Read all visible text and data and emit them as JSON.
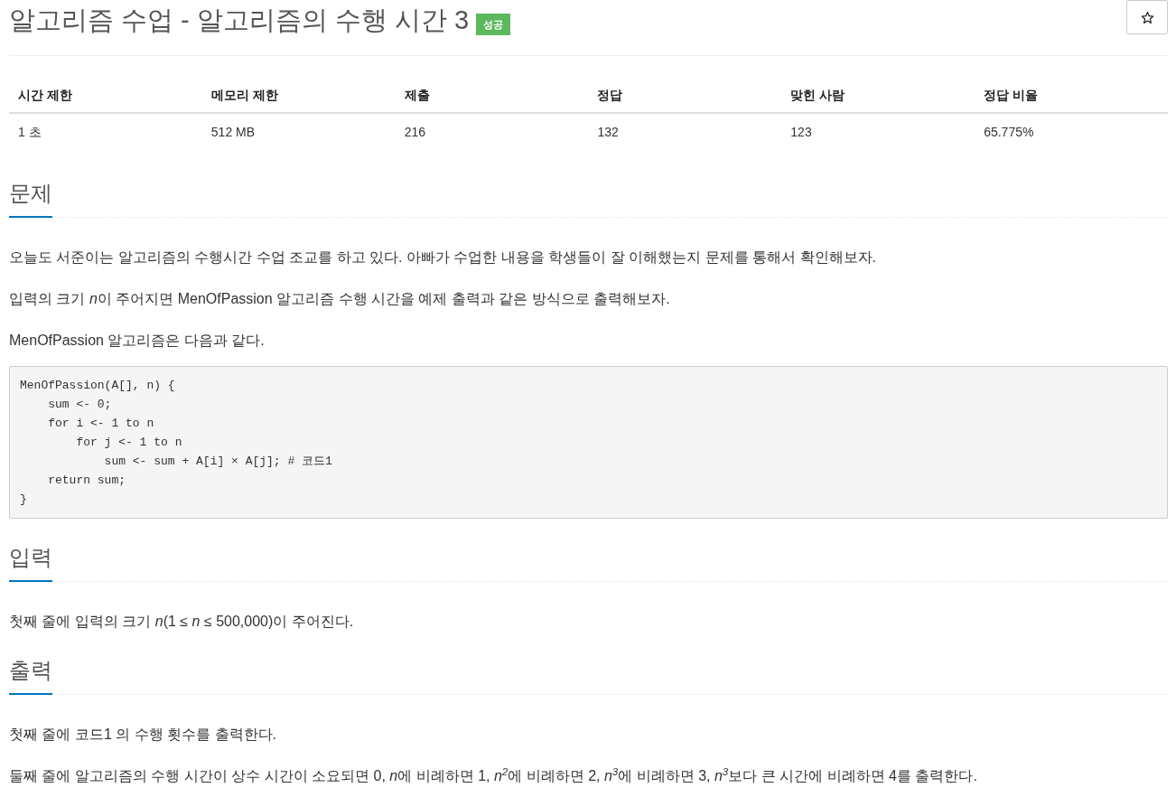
{
  "title": "알고리즘 수업 - 알고리즘의 수행 시간 3",
  "status_badge": "성공",
  "info_table": {
    "columns": [
      "시간 제한",
      "메모리 제한",
      "제출",
      "정답",
      "맞힌 사람",
      "정답 비율"
    ],
    "rows": [
      [
        "1 초",
        "512 MB",
        "216",
        "132",
        "123",
        "65.775%"
      ]
    ]
  },
  "sections": [
    {
      "heading": "문제",
      "paragraphs": [
        [
          "오늘도 서준이는 알고리즘의 수행시간 수업 조교를 하고 있다. 아빠가 수업한 내용을 학생들이 잘 이해했는지 문제를 통해서 확인해보자."
        ],
        [
          "입력의 크기 *n*",
          "이 주어지면 MenOfPassion 알고리즘 수행 시간을 예제 출력과 같은 방식으로 출력해보자."
        ],
        [
          "MenOfPassion 알고리즘은 다음과 같다."
        ]
      ],
      "code_lines": [
        "MenOfPassion(A[], n) {",
        "    sum <- 0;",
        "    for i <- 1 to n",
        "        for j <- 1 to n",
        "            sum <- sum + A[i] × A[j]; # 코드1",
        "    return sum;",
        "}"
      ]
    },
    {
      "heading": "입력",
      "paragraphs": [
        [
          "첫째 줄에 입력의 크기 *n*(1 ≤ *n* ≤ 500,000)이 주어진다."
        ]
      ]
    },
    {
      "heading": "출력",
      "paragraphs": [
        [
          "첫째 줄에 코드1 의 수행 횟수를 출력한다."
        ],
        [
          "둘째 줄에 알고리즘의 수행 시간이 상수 시간이 소요되면 0, *n*",
          "에 비례하면 1, *n*$^{2}$에 비례하면 2, *n*$^{3}$에 비례하면 3, *n*$^{3}$보다 큰 시간에 비례하면 4를 출력한다."
        ]
      ]
    }
  ]
}
